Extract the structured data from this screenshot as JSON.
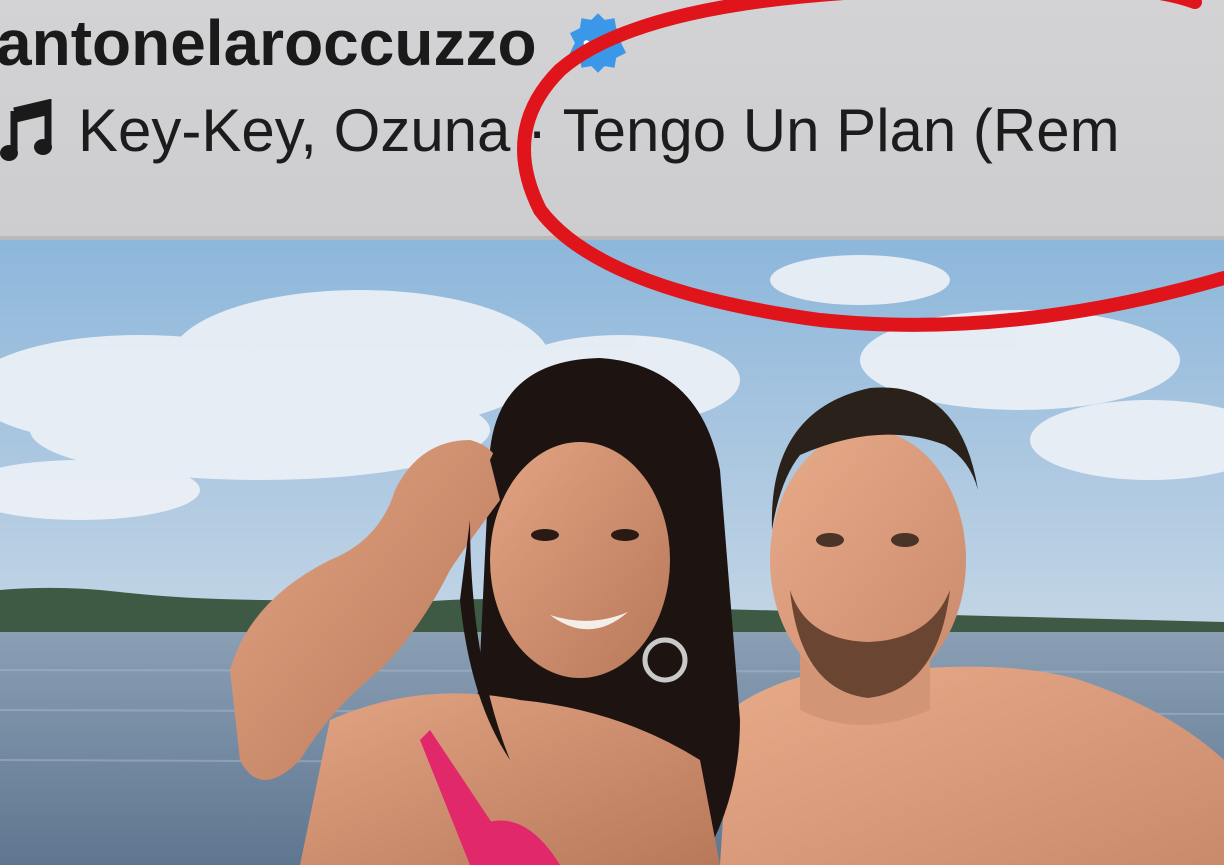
{
  "post": {
    "username": "antonelaroccuzzo",
    "verified": true,
    "audio": "Key-Key, Ozuna · Tengo Un Plan (Rem"
  },
  "icons": {
    "verified": "verified-badge-icon",
    "music": "music-note-icon"
  },
  "colors": {
    "verified_blue": "#3b97e8",
    "highlight_red": "#e0141b",
    "header_bg": "#d0d0d2"
  }
}
